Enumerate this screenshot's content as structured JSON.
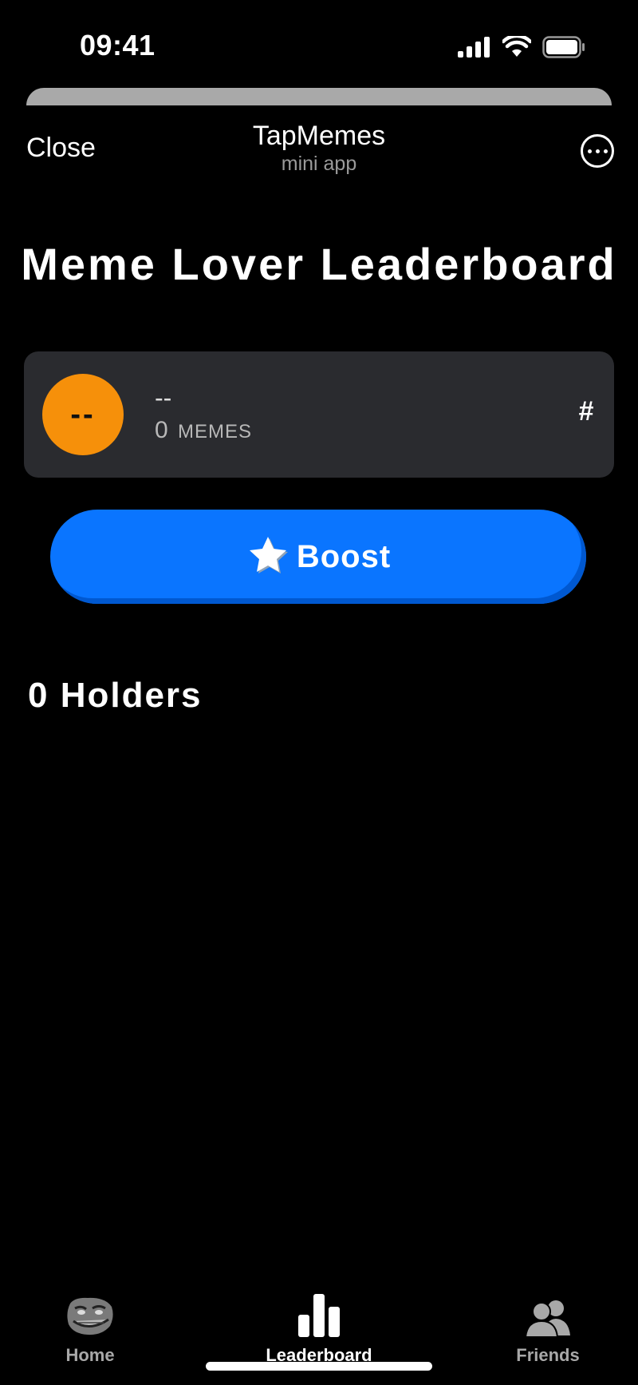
{
  "status_bar": {
    "time": "09:41",
    "icons": [
      "cellular-signal-icon",
      "wifi-icon",
      "battery-icon"
    ]
  },
  "header": {
    "close_label": "Close",
    "title": "TapMemes",
    "subtitle": "mini app",
    "more_icon": "ellipsis-circle-icon"
  },
  "page": {
    "title": "Meme Lover Leaderboard"
  },
  "user_card": {
    "avatar_initials": "--",
    "name": "--",
    "memes_count": "0",
    "memes_unit": "MEMES",
    "rank": "#"
  },
  "boost": {
    "label": "Boost",
    "icon": "star-icon"
  },
  "holders": {
    "label": "0 Holders"
  },
  "tabs": [
    {
      "label": "Home",
      "icon": "troll-face-icon",
      "active": false
    },
    {
      "label": "Leaderboard",
      "icon": "bar-chart-icon",
      "active": true
    },
    {
      "label": "Friends",
      "icon": "people-icon",
      "active": false
    }
  ],
  "colors": {
    "background": "#000000",
    "card": "#2a2b2f",
    "avatar": "#f6900a",
    "accent": "#0a75ff"
  }
}
